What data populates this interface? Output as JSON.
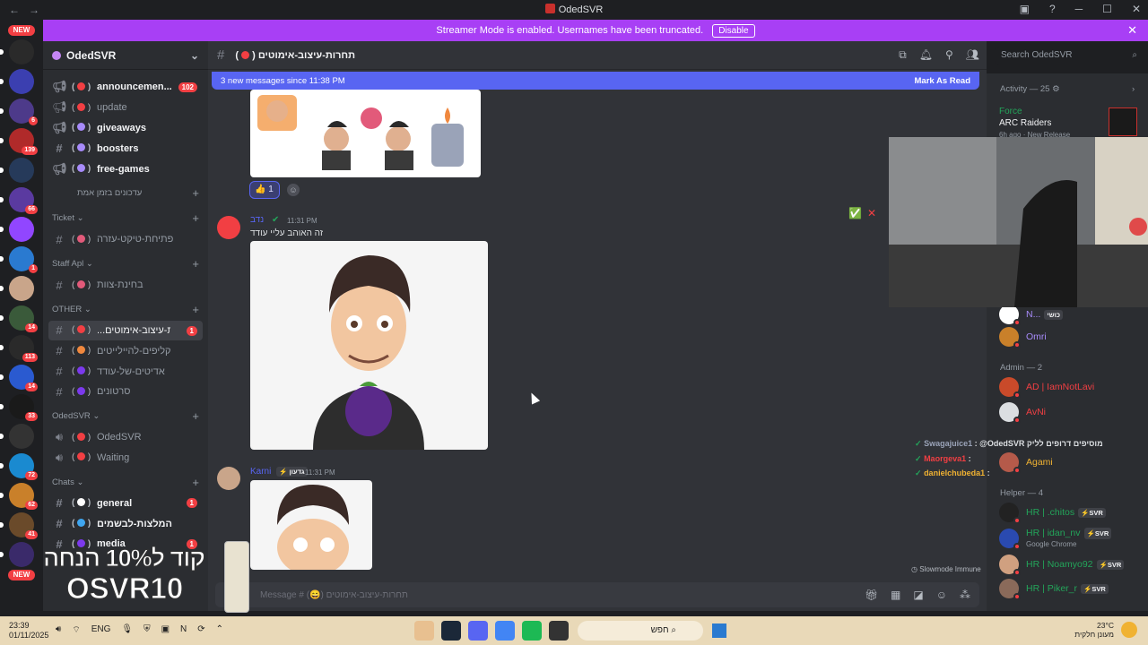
{
  "window": {
    "title": "OdedSVR",
    "nav_back": "←",
    "nav_forward": "→"
  },
  "banner": {
    "text": "Streamer Mode is enabled. Usernames have been truncated.",
    "disable_label": "Disable",
    "close": "✕"
  },
  "guilds": {
    "new_label": "NEW",
    "items": [
      {
        "color": "#2a2a2a",
        "badge": ""
      },
      {
        "color": "#3b3fb0",
        "badge": ""
      },
      {
        "color": "#4d3a8a",
        "badge": "6"
      },
      {
        "color": "#b02a2a",
        "badge": "139"
      },
      {
        "color": "#263a5a",
        "badge": ""
      },
      {
        "color": "#5a3aa0",
        "badge": "66"
      },
      {
        "color": "#9146ff",
        "badge": ""
      },
      {
        "color": "#2a7ad0",
        "badge": "1"
      },
      {
        "color": "#c9a58a",
        "badge": ""
      },
      {
        "color": "#3a5a3a",
        "badge": "14"
      },
      {
        "color": "#2a2a2a",
        "badge": "113"
      },
      {
        "color": "#2a5ad0",
        "badge": "14"
      },
      {
        "color": "#1a1a1a",
        "badge": "33"
      },
      {
        "color": "#333",
        "badge": ""
      },
      {
        "color": "#1a8ad0",
        "badge": "72"
      },
      {
        "color": "#c9802a",
        "badge": "62"
      },
      {
        "color": "#6a4a2a",
        "badge": "41"
      },
      {
        "color": "#3a2a6a",
        "badge": ""
      }
    ],
    "bottom_new": "NEW"
  },
  "sidebar": {
    "server_name": "OdedSVR",
    "channels": [
      {
        "name": "announcemen...",
        "emoji_color": "#f23f43",
        "type": "announce",
        "unread": true,
        "count": "102"
      },
      {
        "name": "update",
        "emoji_color": "#f23f43",
        "type": "announce",
        "unread": false,
        "count": ""
      },
      {
        "name": "giveaways",
        "emoji_color": "#a78bfa",
        "type": "announce",
        "unread": true,
        "count": ""
      },
      {
        "name": "boosters",
        "emoji_color": "#a78bfa",
        "type": "text",
        "unread": true,
        "count": ""
      },
      {
        "name": "free-games",
        "emoji_color": "#a78bfa",
        "type": "announce",
        "unread": true,
        "count": ""
      }
    ],
    "cat_updates": "עדכונים בזמן אמת",
    "cat_ticket": "Ticket",
    "ticket_channel": "פתיחת-טיקט-עזרה",
    "cat_staff": "Staff Apl",
    "staff_channel": "בחינת-צוות",
    "cat_other": "OTHER",
    "other_channels": [
      {
        "name": "...ות-עיצוב-אימוטים",
        "emoji_color": "#f23f43",
        "active": true,
        "count": "1"
      },
      {
        "name": "קליפים-להיילייטים",
        "emoji_color": "#f0883e",
        "active": false,
        "count": ""
      },
      {
        "name": "אדיטים-של-עודד",
        "emoji_color": "#7c3aed",
        "active": false,
        "count": ""
      },
      {
        "name": "סרטונים",
        "emoji_color": "#7c3aed",
        "active": false,
        "count": ""
      }
    ],
    "cat_voice": "OdedSVR",
    "voice_channels": [
      {
        "name": "OdedSVR",
        "emoji_color": "#f23f43"
      },
      {
        "name": "Waiting",
        "emoji_color": "#f23f43"
      }
    ],
    "cat_chats": "Chats",
    "chat_channels": [
      {
        "name": "general",
        "emoji_color": "#fff",
        "count": "1"
      },
      {
        "name": "המלצות-לבשמים",
        "emoji_color": "#3fa6f0",
        "count": ""
      },
      {
        "name": "media",
        "emoji_color": "#7c3aed",
        "count": "1"
      }
    ]
  },
  "chat": {
    "channel_name": "תחרות-עיצוב-אימוטים",
    "new_messages": "3 new messages since 11:38 PM",
    "mark_read": "Mark As Read",
    "reaction_emoji": "👍",
    "reaction_count": "1",
    "msg1_author": "נדב",
    "msg1_time": "11:31 PM",
    "msg1_text": "זה האוהב עליי עודד",
    "msg2_author": "Karni",
    "msg2_badge": "⚡ גדעון",
    "msg2_time": "11:31 PM",
    "composer_placeholder": "Message # (😄) תחרות-עיצוב-אימוטים",
    "slowmode": "Slowmode Immune",
    "search_placeholder": "Search OdedSVR",
    "search_icon": "search-icon"
  },
  "members": {
    "activity_label": "Activity — 25",
    "activity_game_user": "Force",
    "activity_game": "ARC Raiders",
    "activity_meta": "6h ago · New Release",
    "member_n": "N...",
    "member_n_tag": "כושי",
    "member_omri": "Omri",
    "admin_section": "Admin — 2",
    "admin1": "AD | IamNotLavi",
    "admin2": "AvNi",
    "member_agami": "Agami",
    "helper_section": "Helper — 4",
    "helper1": "HR | .chitos",
    "helper2": "HR | idan_nv",
    "helper2_sub": "Google Chrome",
    "helper3": "HR | Noamyo92",
    "helper4": "HR | Piker_r",
    "svr_tag": "⚡SVR",
    "name_colors": {
      "admin": "#f23f43",
      "helper": "#23a55a",
      "omri": "#a78bfa",
      "agami": "#f0b232"
    }
  },
  "overlay_chat": {
    "line1_user": "Swagajuice1",
    "line1_text": "@OdedSVR מוסיפים דרופים לליק",
    "line2_user": "Maorgeva1",
    "line3_user": "danielchubeda1"
  },
  "promo": {
    "line1": "קוד ל10% הנחה",
    "line2": "OSVR10"
  },
  "taskbar": {
    "time": "23:39",
    "date": "01/11/2025",
    "lang": "ENG",
    "search_text": "חפש",
    "temp": "23°C",
    "weather": "מעונן חלקית"
  }
}
